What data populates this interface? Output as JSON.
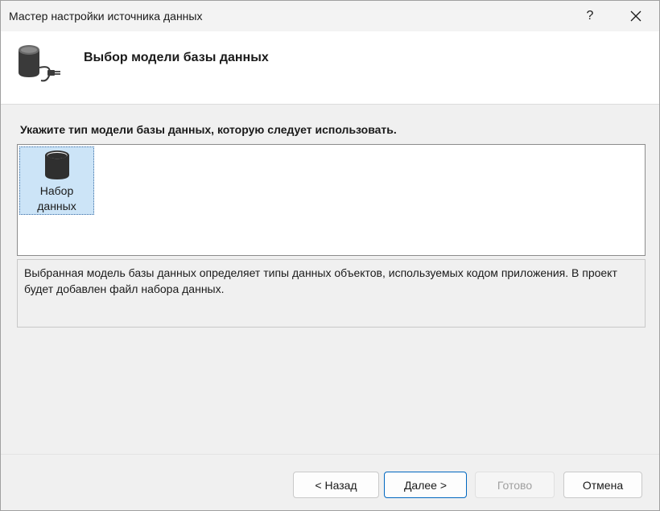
{
  "window": {
    "title": "Мастер настройки источника данных",
    "help_label": "?",
    "close_label": "✕"
  },
  "header": {
    "title": "Выбор модели базы данных",
    "icon": "database-plug-icon"
  },
  "main": {
    "prompt": "Укажите тип модели базы данных, которую следует использовать.",
    "models": [
      {
        "label": "Набор данных",
        "icon": "database-icon",
        "selected": true
      }
    ],
    "description": "Выбранная модель базы данных определяет типы данных объектов, используемых кодом приложения. В проект будет добавлен файл набора данных."
  },
  "footer": {
    "back_label": "< Назад",
    "next_label": "Далее >",
    "finish_label": "Готово",
    "cancel_label": "Отмена"
  },
  "colors": {
    "selection": "#cce4f7",
    "accent": "#0067c0",
    "disabled_text": "#a0a0a0"
  }
}
